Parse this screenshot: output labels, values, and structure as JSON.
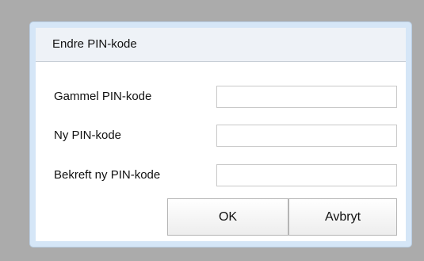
{
  "dialog": {
    "title": "Endre PIN-kode",
    "fields": [
      {
        "label": "Gammel PIN-kode",
        "value": ""
      },
      {
        "label": "Ny PIN-kode",
        "value": ""
      },
      {
        "label": "Bekreft ny PIN-kode",
        "value": ""
      }
    ],
    "buttons": {
      "ok_label": "OK",
      "cancel_label": "Avbryt"
    }
  },
  "colors": {
    "backdrop": "#ababab",
    "dialog_border": "#d5e6f7",
    "titlebar": "#eef2f7"
  }
}
